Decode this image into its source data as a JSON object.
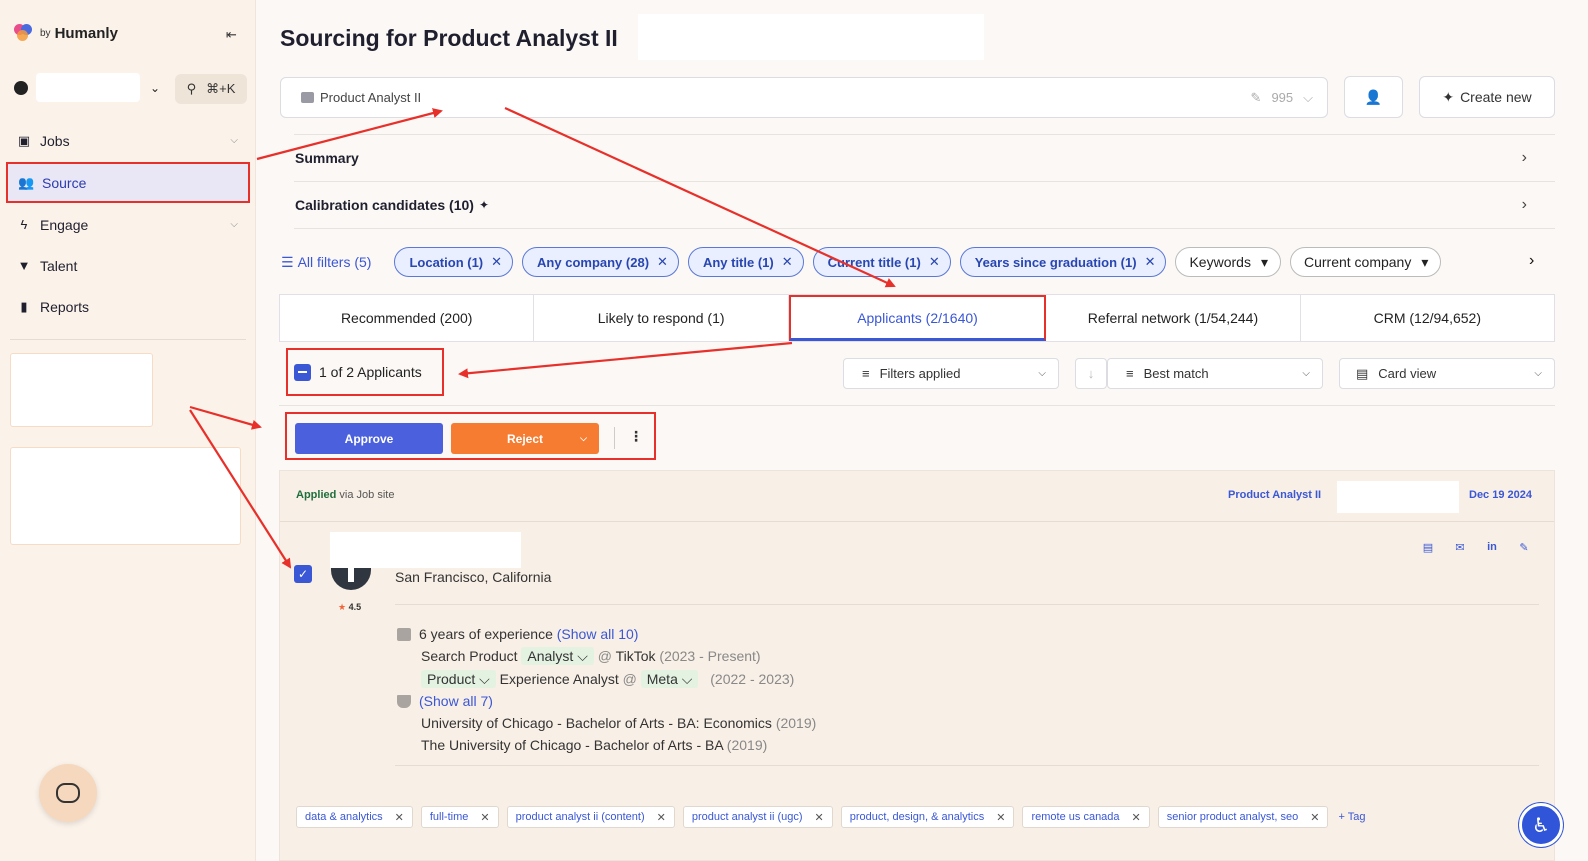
{
  "brand": {
    "by": "by",
    "name": "Humanly"
  },
  "sidebar": {
    "search_shortcut": "⌘+K",
    "items": [
      {
        "label": "Jobs",
        "icon": "briefcase-icon"
      },
      {
        "label": "Source",
        "icon": "users-icon",
        "active": true
      },
      {
        "label": "Engage",
        "icon": "bolt-icon"
      },
      {
        "label": "Talent",
        "icon": "funnel-icon"
      },
      {
        "label": "Reports",
        "icon": "bar-chart-icon"
      }
    ]
  },
  "header": {
    "title": "Sourcing for Product Analyst II",
    "job_select_value": "Product Analyst II",
    "job_count": "995",
    "create_new": "Create new"
  },
  "accordions": {
    "summary": "Summary",
    "calibration": "Calibration candidates (10)"
  },
  "filters": {
    "all_filters": "All filters (5)",
    "chips": [
      "Location (1)",
      "Any company (28)",
      "Any title (1)",
      "Current title (1)",
      "Years since graduation (1)"
    ],
    "dropdowns": [
      "Keywords",
      "Current company"
    ]
  },
  "tabs": [
    "Recommended (200)",
    "Likely to respond (1)",
    "Applicants (2/1640)",
    "Referral network (1/54,244)",
    "CRM (12/94,652)"
  ],
  "toolbar": {
    "selection": "1 of 2 Applicants",
    "filters_applied": "Filters applied",
    "sort": "Best match",
    "view": "Card view",
    "approve": "Approve",
    "reject": "Reject"
  },
  "candidate": {
    "applied_label": "Applied",
    "applied_via": "via Job site",
    "job": "Product Analyst II",
    "date": "Dec 19 2024",
    "rating": "4.5",
    "location": "San Francisco, California",
    "experience_summary": "6 years of experience",
    "show_all_exp": "(Show all 10)",
    "jobs": [
      {
        "title_a": "Search Product",
        "title_b": "Analyst",
        "at": "@",
        "company": "TikTok",
        "dates": "(2023 - Present)"
      },
      {
        "title_a": "Product",
        "title_b": "Experience Analyst",
        "at": "@",
        "company": "Meta",
        "dates": "(2022 - 2023)"
      }
    ],
    "show_all_edu": "(Show all 7)",
    "education": [
      {
        "school": "University of Chicago - Bachelor of Arts - BA: Economics",
        "year": "(2019)"
      },
      {
        "school": "The University of Chicago - Bachelor of Arts - BA",
        "year": "(2019)"
      }
    ],
    "tags": [
      "data & analytics",
      "full-time",
      "product analyst ii (content)",
      "product analyst ii (ugc)",
      "product, design, & analytics",
      "remote us canada",
      "senior product analyst, seo"
    ],
    "add_tag": "+ Tag"
  },
  "colors": {
    "accent": "#3a57d6",
    "reject": "#f57c30",
    "annotation": "#e8302a"
  }
}
